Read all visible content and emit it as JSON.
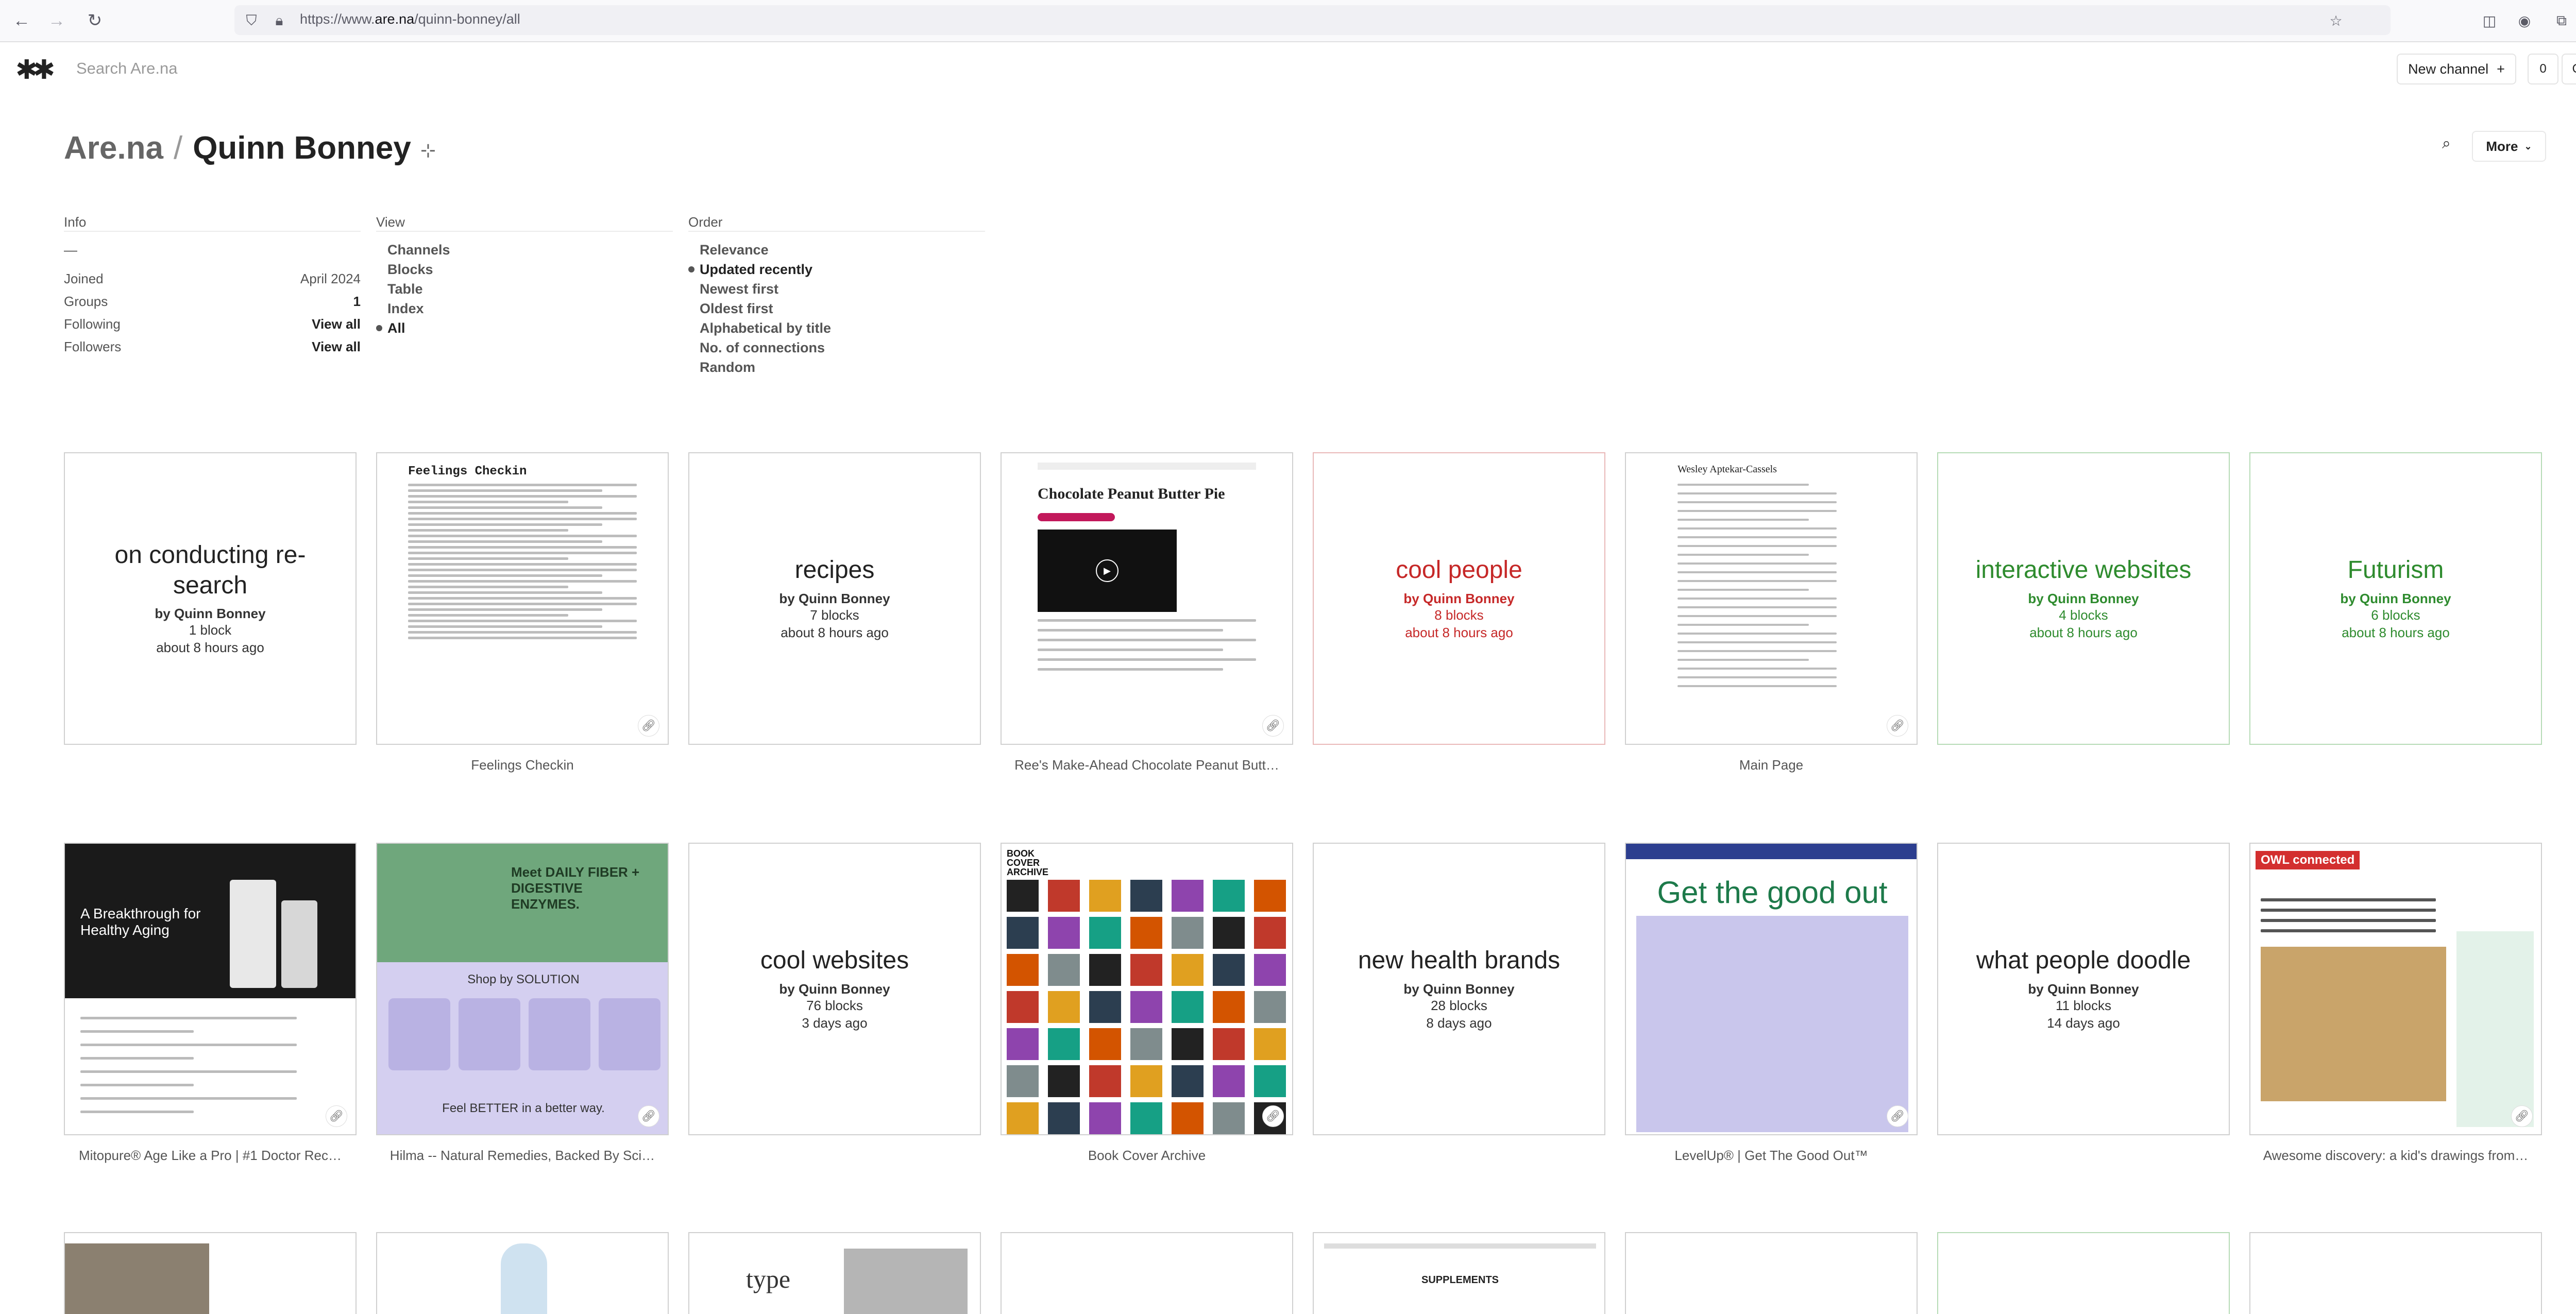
{
  "browser": {
    "url_prefix": "https://www.",
    "url_domain": "are.na",
    "url_path": "/quinn-bonney/all"
  },
  "header": {
    "logo": "✱✱",
    "search_placeholder": "Search Are.na",
    "new_channel_label": "New channel",
    "notifications_count": "0",
    "user_initial": "Q"
  },
  "profile": {
    "crumb": "Are.na",
    "separator": "/",
    "name": "Quinn Bonney",
    "more_label": "More"
  },
  "info": {
    "heading": "Info",
    "dash": "—",
    "rows": [
      {
        "label": "Joined",
        "value": "April 2024"
      },
      {
        "label": "Groups",
        "value": "1"
      },
      {
        "label": "Following",
        "value": "View all"
      },
      {
        "label": "Followers",
        "value": "View all"
      }
    ]
  },
  "view": {
    "heading": "View",
    "options": [
      "Channels",
      "Blocks",
      "Table",
      "Index",
      "All"
    ],
    "selected": "All"
  },
  "order": {
    "heading": "Order",
    "options": [
      "Relevance",
      "Updated recently",
      "Newest first",
      "Oldest first",
      "Alphabetical by title",
      "No. of connections",
      "Random"
    ],
    "selected": "Updated recently"
  },
  "row1": [
    {
      "kind": "channel",
      "title": "on conducting re-search",
      "by": "by Quinn Bonney",
      "count": "1 block",
      "time": "about 8 hours ago"
    },
    {
      "kind": "block",
      "caption": "Feelings Checkin",
      "doc_title": "Feelings Checkin"
    },
    {
      "kind": "channel",
      "title": "recipes",
      "by": "by Quinn Bonney",
      "count": "7 blocks",
      "time": "about 8 hours ago"
    },
    {
      "kind": "block",
      "caption": "Ree's Make-Ahead Chocolate Peanut Butt…",
      "doc_title": "Chocolate Peanut Butter Pie"
    },
    {
      "kind": "channel",
      "title": "cool people",
      "by": "by Quinn Bonney",
      "count": "8 blocks",
      "time": "about 8 hours ago",
      "color": "red"
    },
    {
      "kind": "block",
      "caption": "Main Page",
      "doc_title": "Wesley Aptekar-Cassels"
    },
    {
      "kind": "channel",
      "title": "interactive websites",
      "by": "by Quinn Bonney",
      "count": "4 blocks",
      "time": "about 8 hours ago",
      "color": "green"
    },
    {
      "kind": "channel",
      "title": "Futurism",
      "by": "by Quinn Bonney",
      "count": "6 blocks",
      "time": "about 8 hours ago",
      "color": "green"
    }
  ],
  "row2": [
    {
      "kind": "block",
      "caption": "Mitopure® Age Like a Pro | #1 Doctor Rec…",
      "headline": "A Breakthrough for Healthy Aging"
    },
    {
      "kind": "block",
      "caption": "Hilma -- Natural Remedies, Backed By Sci…",
      "headline": "Meet DAILY FIBER + DIGESTIVE ENZYMES.",
      "sub": "Shop by SOLUTION",
      "foot": "Feel BETTER in a better way."
    },
    {
      "kind": "channel",
      "title": "cool websites",
      "by": "by Quinn Bonney",
      "count": "76 blocks",
      "time": "3 days ago"
    },
    {
      "kind": "block",
      "caption": "Book Cover Archive",
      "headline": "BOOK COVER ARCHIVE"
    },
    {
      "kind": "channel",
      "title": "new health brands",
      "by": "by Quinn Bonney",
      "count": "28 blocks",
      "time": "8 days ago"
    },
    {
      "kind": "block",
      "caption": "LevelUp® | Get The Good Out™",
      "headline": "Get the good out"
    },
    {
      "kind": "channel",
      "title": "what people doodle",
      "by": "by Quinn Bonney",
      "count": "11 blocks",
      "time": "14 days ago"
    },
    {
      "kind": "block",
      "caption": "Awesome discovery: a kid's drawings from…",
      "headline": "OWL connected"
    }
  ],
  "row3": [
    {
      "label": ""
    },
    {
      "label": ""
    },
    {
      "label": "type"
    },
    {
      "label": ""
    },
    {
      "label": "SUPPLEMENTS"
    },
    {
      "label": ""
    },
    {
      "label": ""
    },
    {
      "label": ""
    }
  ],
  "colors": {
    "red": "#c62828",
    "green": "#2e8b2e",
    "border": "#d0d0d0"
  }
}
